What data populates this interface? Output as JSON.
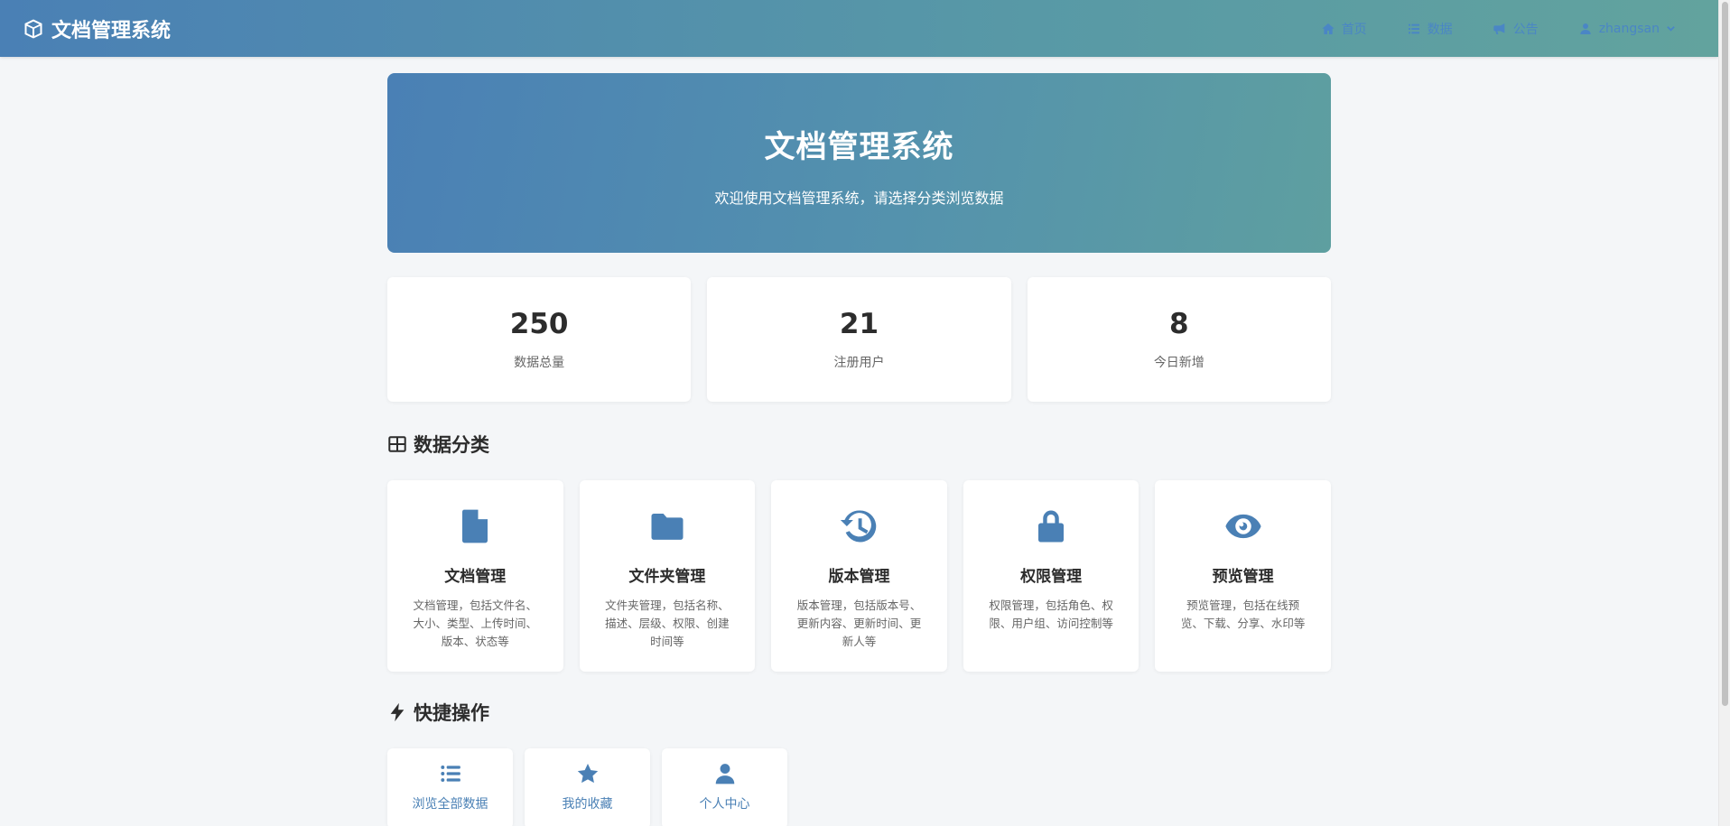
{
  "app": {
    "title": "文档管理系统"
  },
  "nav": {
    "items": [
      {
        "label": "首页",
        "icon": "home-icon"
      },
      {
        "label": "数据",
        "icon": "list-icon"
      },
      {
        "label": "公告",
        "icon": "megaphone-icon"
      }
    ],
    "user": {
      "name": "zhangsan",
      "icon": "user-icon"
    }
  },
  "hero": {
    "title": "文档管理系统",
    "subtitle": "欢迎使用文档管理系统，请选择分类浏览数据"
  },
  "stats": [
    {
      "value": "250",
      "label": "数据总量"
    },
    {
      "value": "21",
      "label": "注册用户"
    },
    {
      "value": "8",
      "label": "今日新增"
    }
  ],
  "categories": {
    "title": "数据分类",
    "items": [
      {
        "name": "文档管理",
        "desc": "文档管理，包括文件名、大小、类型、上传时间、版本、状态等",
        "icon": "file-icon"
      },
      {
        "name": "文件夹管理",
        "desc": "文件夹管理，包括名称、描述、层级、权限、创建时间等",
        "icon": "folder-icon"
      },
      {
        "name": "版本管理",
        "desc": "版本管理，包括版本号、更新内容、更新时间、更新人等",
        "icon": "history-icon"
      },
      {
        "name": "权限管理",
        "desc": "权限管理，包括角色、权限、用户组、访问控制等",
        "icon": "lock-icon"
      },
      {
        "name": "预览管理",
        "desc": "预览管理，包括在线预览、下载、分享、水印等",
        "icon": "eye-icon"
      }
    ]
  },
  "quick": {
    "title": "快捷操作",
    "items": [
      {
        "label": "浏览全部数据",
        "icon": "list-icon"
      },
      {
        "label": "我的收藏",
        "icon": "star-icon"
      },
      {
        "label": "个人中心",
        "icon": "user-icon"
      }
    ]
  },
  "colors": {
    "accent": "#4a80b5",
    "nav_link": "#4a86c5",
    "background": "#f4f6f8"
  }
}
